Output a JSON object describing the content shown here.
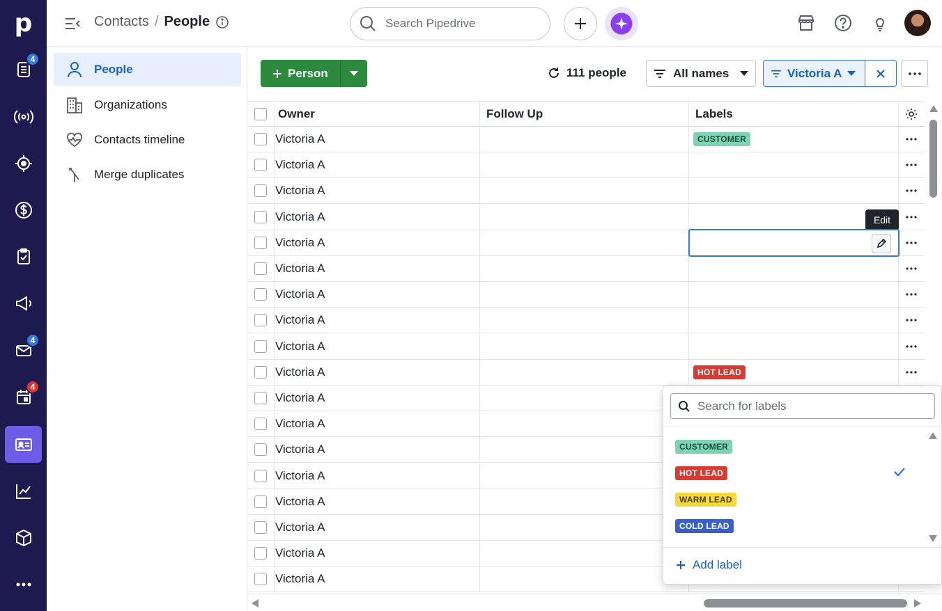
{
  "rail": {
    "logo": "p",
    "badges": {
      "activity": "4",
      "mail": "4",
      "calendar": "4"
    }
  },
  "topbar": {
    "breadcrumb_parent": "Contacts",
    "breadcrumb_sep": "/",
    "breadcrumb_current": "People",
    "search_placeholder": "Search Pipedrive"
  },
  "sidebar": {
    "items": [
      {
        "label": "People"
      },
      {
        "label": "Organizations"
      },
      {
        "label": "Contacts timeline"
      },
      {
        "label": "Merge duplicates"
      }
    ]
  },
  "toolbar": {
    "add_label": "Person",
    "count": "111 people",
    "filter_label": "All names",
    "owner_filter_label": "Victoria A"
  },
  "table": {
    "columns": {
      "owner": "Owner",
      "follow_up": "Follow Up",
      "labels": "Labels"
    },
    "rows": [
      {
        "owner": "Victoria A",
        "label": "CUSTOMER"
      },
      {
        "owner": "Victoria A",
        "label": ""
      },
      {
        "owner": "Victoria A",
        "label": ""
      },
      {
        "owner": "Victoria A",
        "label": ""
      },
      {
        "owner": "Victoria A",
        "label": ""
      },
      {
        "owner": "Victoria A",
        "label": ""
      },
      {
        "owner": "Victoria A",
        "label": ""
      },
      {
        "owner": "Victoria A",
        "label": ""
      },
      {
        "owner": "Victoria A",
        "label": ""
      },
      {
        "owner": "Victoria A",
        "label": "HOT LEAD"
      },
      {
        "owner": "Victoria A",
        "label": ""
      },
      {
        "owner": "Victoria A",
        "label": ""
      },
      {
        "owner": "Victoria A",
        "label": ""
      },
      {
        "owner": "Victoria A",
        "label": ""
      },
      {
        "owner": "Victoria A",
        "label": ""
      },
      {
        "owner": "Victoria A",
        "label": ""
      },
      {
        "owner": "Victoria A",
        "label": ""
      },
      {
        "owner": "Victoria A",
        "label": ""
      }
    ]
  },
  "tooltip": "Edit",
  "label_dropdown": {
    "search_placeholder": "Search for labels",
    "options": [
      {
        "label": "CUSTOMER",
        "checked": false
      },
      {
        "label": "HOT LEAD",
        "checked": true
      },
      {
        "label": "WARM LEAD",
        "checked": false
      },
      {
        "label": "COLD LEAD",
        "checked": false
      }
    ],
    "add_label": "Add label"
  },
  "colors": {
    "rail_bg": "#1c1a4f",
    "accent": "#317ae2",
    "add_button": "#2b8a3e",
    "customer": "#7ed3b2",
    "hot_lead": "#d93b32",
    "warm_lead": "#f7d83a",
    "cold_lead": "#3b5fc9"
  }
}
